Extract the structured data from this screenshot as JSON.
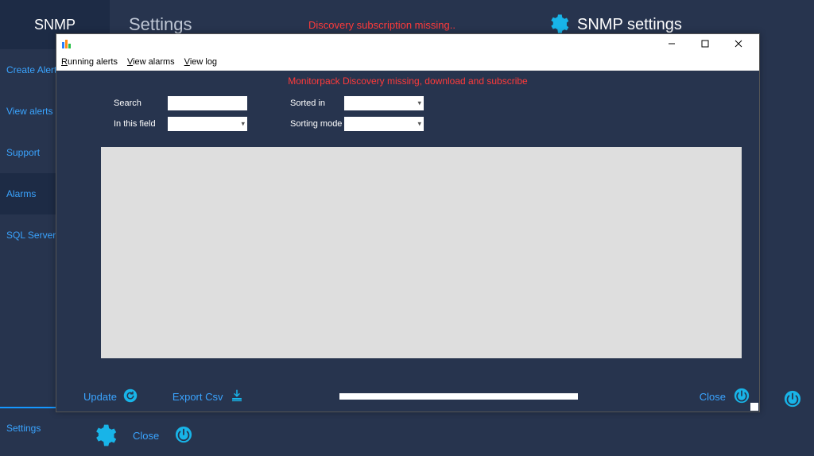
{
  "colors": {
    "accent": "#3aa4ff",
    "accent_cyan": "#18b4e8",
    "warn": "#ff3a3a"
  },
  "topbar": {
    "logo": "SNMP",
    "title": "Settings",
    "warning": "Discovery subscription missing..",
    "snmp": "SNMP settings"
  },
  "sidebar": {
    "items": [
      {
        "label": "Create Alert"
      },
      {
        "label": "View alerts"
      },
      {
        "label": "Support"
      },
      {
        "label": "Alarms"
      },
      {
        "label": "SQL Server"
      }
    ],
    "bottom": "Settings"
  },
  "main_footer": {
    "close": "Close"
  },
  "modal": {
    "menu": {
      "running": "Running alerts",
      "view_alarms": "View alarms",
      "view_log": "View log"
    },
    "warning": "Monitorpack Discovery missing, download and subscribe",
    "filters": {
      "search_label": "Search",
      "search_value": "",
      "field_label": "In this field",
      "field_value": "",
      "sorted_label": "Sorted in",
      "sorted_value": "",
      "mode_label": "Sorting mode",
      "mode_value": ""
    },
    "footer": {
      "update": "Update",
      "export": "Export Csv",
      "close": "Close"
    }
  }
}
